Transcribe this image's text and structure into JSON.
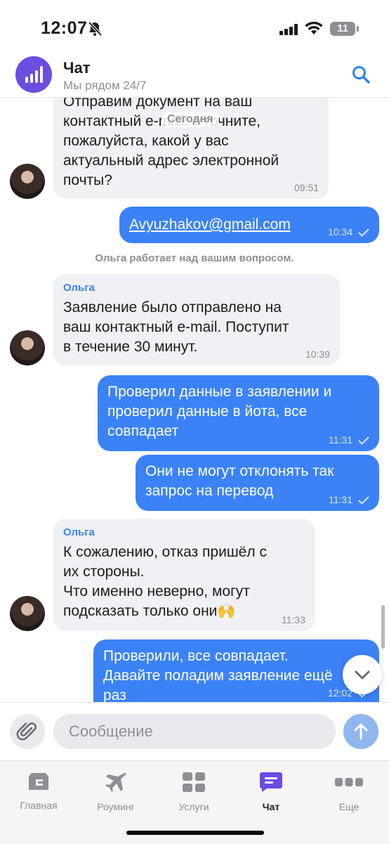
{
  "status_bar": {
    "time": "12:07",
    "battery": "11"
  },
  "header": {
    "title": "Чат",
    "subtitle": "Мы рядом 24/7"
  },
  "date_pill": "Сегодня",
  "messages": [
    {
      "text": "Отправим документ на ваш\nконтактный е-mail. Уточните,\nпожалуйста, какой у вас\nактуальный адрес электронной\nпочты?",
      "time": "09:51"
    },
    {
      "text": "Avyuzhakov@gmail.com",
      "time": "10:34"
    },
    {
      "text": "Ольга работает над вашим вопросом."
    },
    {
      "sender": "Ольга",
      "text": "Заявление было отправлено на\nваш контактный e-mail. Поступит\nв течение 30 минут.",
      "time": "10:39"
    },
    {
      "text": "Проверил данные в заявлении и\nпроверил данные в йота, все\nсовпадает",
      "time": "11:31"
    },
    {
      "text": "Они не могут отклонять так\nзапрос на перевод",
      "time": "11:31"
    },
    {
      "sender": "Ольга",
      "text": "К сожалению, отказ пришёл с\nих стороны.\nЧто именно неверно, могут\nподсказать только они🙌",
      "time": "11:33"
    },
    {
      "text": "Проверили, все совпадает.\nДавайте поладим заявление ещё\nраз",
      "time": "12:02"
    }
  ],
  "composer": {
    "placeholder": "Сообщение"
  },
  "tabs": [
    {
      "label": "Главная",
      "icon": "home-icon"
    },
    {
      "label": "Роуминг",
      "icon": "airplane-icon"
    },
    {
      "label": "Услуги",
      "icon": "services-grid-icon"
    },
    {
      "label": "Чат",
      "icon": "chat-icon",
      "active": true
    },
    {
      "label": "Еще",
      "icon": "more-dots-icon"
    }
  ],
  "colors": {
    "accent": "#3b82f6",
    "brand": "#6b4de0",
    "incoming_bubble": "#f0f1f4",
    "outgoing_bubble": "#3b82f6"
  }
}
